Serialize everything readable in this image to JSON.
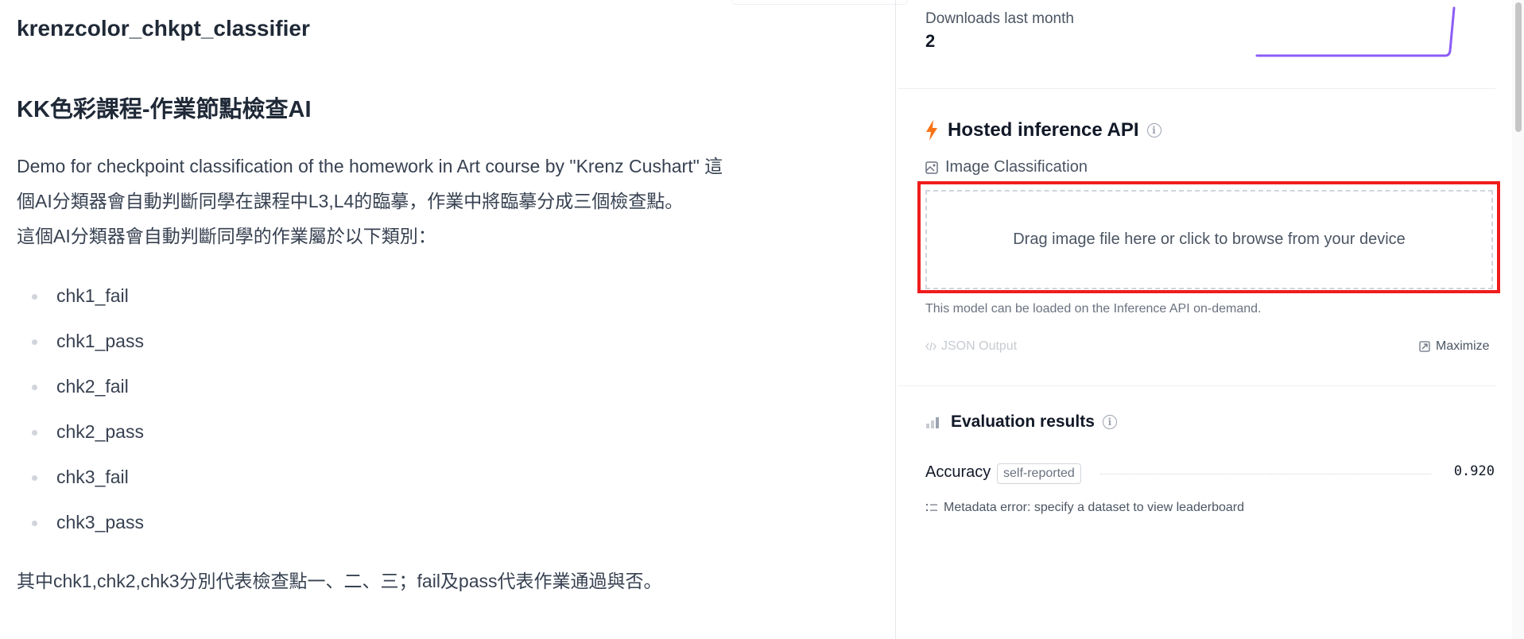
{
  "model": {
    "title": "krenzcolor_chkpt_classifier"
  },
  "readme": {
    "heading": "KK色彩課程-作業節點檢查AI",
    "description_lines": [
      "Demo for checkpoint classification of the homework in Art course by \"Krenz Cushart\" 這",
      "個AI分類器會自動判斷同學在課程中L3,L4的臨摹，作業中將臨摹分成三個檢查點。",
      "這個AI分類器會自動判斷同學的作業屬於以下類別："
    ],
    "classes": [
      "chk1_fail",
      "chk1_pass",
      "chk2_fail",
      "chk2_pass",
      "chk3_fail",
      "chk3_pass"
    ],
    "footer": "其中chk1,chk2,chk3分別代表檢查點一、二、三；fail及pass代表作業通過與否。"
  },
  "downloads": {
    "label": "Downloads last month",
    "count": "2",
    "sparkline_color": "#8b5cf6"
  },
  "inference": {
    "title": "Hosted inference API",
    "task_label": "Image Classification",
    "dropzone_text": "Drag image file here or click to browse from your device",
    "note": "This model can be loaded on the Inference API on-demand.",
    "json_output_label": "JSON Output",
    "maximize_label": "Maximize",
    "icons": {
      "title": "lightning-icon",
      "info": "info-icon",
      "task": "image-classification-icon",
      "json": "code-icon",
      "maximize": "maximize-icon"
    },
    "accent_color": "#f97316",
    "highlight_color": "#ef1c1c"
  },
  "evaluation": {
    "title": "Evaluation results",
    "metric_name": "Accuracy",
    "metric_badge": "self-reported",
    "metric_value": "0.920",
    "metadata_error": "Metadata error: specify a dataset to view leaderboard"
  }
}
